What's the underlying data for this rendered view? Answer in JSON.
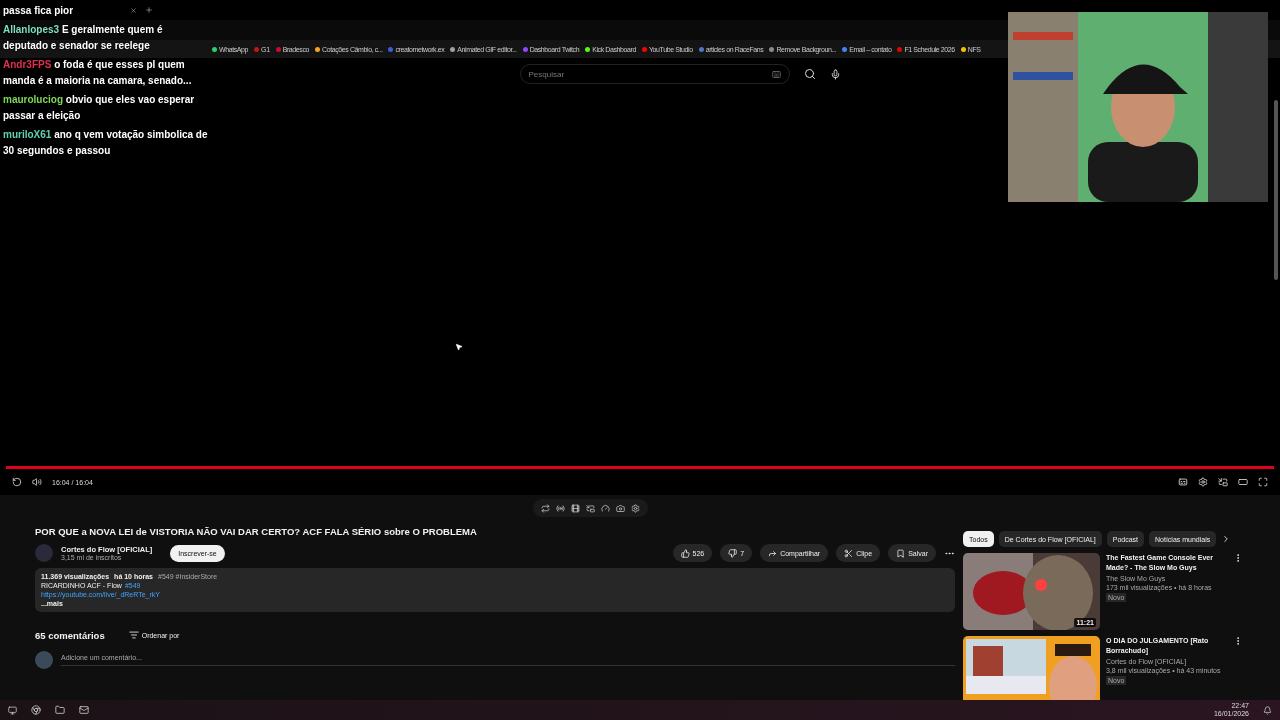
{
  "chat": {
    "messages": [
      {
        "text": "passa fica pior"
      },
      {
        "user": "Allanlopes3",
        "color": "#7fe0c0",
        "text": "E geralmente quem é deputado e senador se reelege"
      },
      {
        "user": "Andr3FPS",
        "color": "#e0304a",
        "text": "o foda é que esses pl quem manda é a maioria na camara, senado..."
      },
      {
        "user": "mauroluciog",
        "color": "#7ed957",
        "text": "obvio que eles vao esperar passar a eleição"
      },
      {
        "user": "muriloX61",
        "color": "#60d0b0",
        "text": "ano q vem votação simbolica de 30 segundos e passou"
      }
    ]
  },
  "bookmarks": [
    {
      "label": "WhatsApp",
      "color": "#25d366"
    },
    {
      "label": "G1",
      "color": "#c4170c"
    },
    {
      "label": "Bradesco",
      "color": "#cc092f"
    },
    {
      "label": "Cotações Câmbio, c...",
      "color": "#f5a623"
    },
    {
      "label": "creatornetwork.ex",
      "color": "#3b5bdb"
    },
    {
      "label": "Animated GIF editor...",
      "color": "#9aa0a6"
    },
    {
      "label": "Dashboard Twitch",
      "color": "#9146ff"
    },
    {
      "label": "Kick Dashboard",
      "color": "#53fc18"
    },
    {
      "label": "YouTube Studio",
      "color": "#ff0000"
    },
    {
      "label": "articles on RaceFans",
      "color": "#4a78c2"
    },
    {
      "label": "Remove Backgroun...",
      "color": "#8a8a8a"
    },
    {
      "label": "Email – contato",
      "color": "#4285f4"
    },
    {
      "label": "F1 Schedule 2026",
      "color": "#e10600"
    },
    {
      "label": "NFS",
      "color": "#f0c000"
    }
  ],
  "search": {
    "placeholder": "Pesquisar"
  },
  "player": {
    "level": 1,
    "time": "16:04 / 16:04"
  },
  "video": {
    "title": "POR QUE a NOVA LEI de VISTORIA NÃO VAI DAR CERTO? ACF FALA SÉRIO sobre O PROBLEMA",
    "channel": "Cortes do Flow [OFICIAL]",
    "subscribers": "3,15 mi de inscritos",
    "subscribe": "Inscrever-se",
    "likes": "526",
    "dislikes": "7",
    "actions": [
      "Compartilhar",
      "Clipe",
      "Salvar"
    ]
  },
  "description": {
    "views": "11.369 visualizações",
    "age": "há 10 horas",
    "tags": "#549 #InsiderStore",
    "line": "RICARDINHO ACF - Flow",
    "line_tag": "#549",
    "link": "https://youtube.com/live/_dReRTe_rkY",
    "more": "...mais"
  },
  "comments": {
    "count": "65 comentários",
    "sort": "Ordenar por",
    "placeholder": "Adicione um comentário..."
  },
  "chips": [
    {
      "label": "Todos",
      "selected": true
    },
    {
      "label": "De Cortes do Flow [OFICIAL]",
      "selected": false
    },
    {
      "label": "Podcast",
      "selected": false
    },
    {
      "label": "Notícias mundiais",
      "selected": false
    }
  ],
  "related": [
    {
      "title": "The Fastest Game Console Ever Made? - The Slow Mo Guys",
      "channel": "The Slow Mo Guys",
      "meta": "173 mil visualizações • há 8 horas",
      "badge": "Novo",
      "duration": "11:21"
    },
    {
      "title": "O DIA DO JULGAMENTO [Rato Borrachudo]",
      "channel": "Cortes do Flow [OFICIAL]",
      "meta": "3,8 mil visualizações • há 43 minutos",
      "badge": "Novo"
    }
  ],
  "taskbar": {
    "time": "22:47",
    "date": "16/01/2026"
  }
}
